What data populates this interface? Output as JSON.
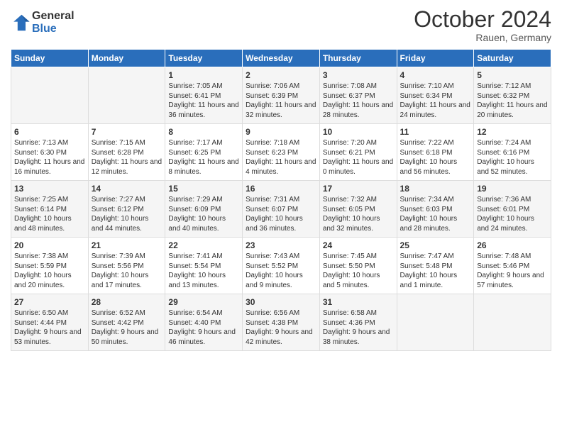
{
  "header": {
    "logo_general": "General",
    "logo_blue": "Blue",
    "month_title": "October 2024",
    "location": "Rauen, Germany"
  },
  "weekdays": [
    "Sunday",
    "Monday",
    "Tuesday",
    "Wednesday",
    "Thursday",
    "Friday",
    "Saturday"
  ],
  "weeks": [
    [
      {
        "day": "",
        "detail": ""
      },
      {
        "day": "",
        "detail": ""
      },
      {
        "day": "1",
        "detail": "Sunrise: 7:05 AM\nSunset: 6:41 PM\nDaylight: 11 hours and 36 minutes."
      },
      {
        "day": "2",
        "detail": "Sunrise: 7:06 AM\nSunset: 6:39 PM\nDaylight: 11 hours and 32 minutes."
      },
      {
        "day": "3",
        "detail": "Sunrise: 7:08 AM\nSunset: 6:37 PM\nDaylight: 11 hours and 28 minutes."
      },
      {
        "day": "4",
        "detail": "Sunrise: 7:10 AM\nSunset: 6:34 PM\nDaylight: 11 hours and 24 minutes."
      },
      {
        "day": "5",
        "detail": "Sunrise: 7:12 AM\nSunset: 6:32 PM\nDaylight: 11 hours and 20 minutes."
      }
    ],
    [
      {
        "day": "6",
        "detail": "Sunrise: 7:13 AM\nSunset: 6:30 PM\nDaylight: 11 hours and 16 minutes."
      },
      {
        "day": "7",
        "detail": "Sunrise: 7:15 AM\nSunset: 6:28 PM\nDaylight: 11 hours and 12 minutes."
      },
      {
        "day": "8",
        "detail": "Sunrise: 7:17 AM\nSunset: 6:25 PM\nDaylight: 11 hours and 8 minutes."
      },
      {
        "day": "9",
        "detail": "Sunrise: 7:18 AM\nSunset: 6:23 PM\nDaylight: 11 hours and 4 minutes."
      },
      {
        "day": "10",
        "detail": "Sunrise: 7:20 AM\nSunset: 6:21 PM\nDaylight: 11 hours and 0 minutes."
      },
      {
        "day": "11",
        "detail": "Sunrise: 7:22 AM\nSunset: 6:18 PM\nDaylight: 10 hours and 56 minutes."
      },
      {
        "day": "12",
        "detail": "Sunrise: 7:24 AM\nSunset: 6:16 PM\nDaylight: 10 hours and 52 minutes."
      }
    ],
    [
      {
        "day": "13",
        "detail": "Sunrise: 7:25 AM\nSunset: 6:14 PM\nDaylight: 10 hours and 48 minutes."
      },
      {
        "day": "14",
        "detail": "Sunrise: 7:27 AM\nSunset: 6:12 PM\nDaylight: 10 hours and 44 minutes."
      },
      {
        "day": "15",
        "detail": "Sunrise: 7:29 AM\nSunset: 6:09 PM\nDaylight: 10 hours and 40 minutes."
      },
      {
        "day": "16",
        "detail": "Sunrise: 7:31 AM\nSunset: 6:07 PM\nDaylight: 10 hours and 36 minutes."
      },
      {
        "day": "17",
        "detail": "Sunrise: 7:32 AM\nSunset: 6:05 PM\nDaylight: 10 hours and 32 minutes."
      },
      {
        "day": "18",
        "detail": "Sunrise: 7:34 AM\nSunset: 6:03 PM\nDaylight: 10 hours and 28 minutes."
      },
      {
        "day": "19",
        "detail": "Sunrise: 7:36 AM\nSunset: 6:01 PM\nDaylight: 10 hours and 24 minutes."
      }
    ],
    [
      {
        "day": "20",
        "detail": "Sunrise: 7:38 AM\nSunset: 5:59 PM\nDaylight: 10 hours and 20 minutes."
      },
      {
        "day": "21",
        "detail": "Sunrise: 7:39 AM\nSunset: 5:56 PM\nDaylight: 10 hours and 17 minutes."
      },
      {
        "day": "22",
        "detail": "Sunrise: 7:41 AM\nSunset: 5:54 PM\nDaylight: 10 hours and 13 minutes."
      },
      {
        "day": "23",
        "detail": "Sunrise: 7:43 AM\nSunset: 5:52 PM\nDaylight: 10 hours and 9 minutes."
      },
      {
        "day": "24",
        "detail": "Sunrise: 7:45 AM\nSunset: 5:50 PM\nDaylight: 10 hours and 5 minutes."
      },
      {
        "day": "25",
        "detail": "Sunrise: 7:47 AM\nSunset: 5:48 PM\nDaylight: 10 hours and 1 minute."
      },
      {
        "day": "26",
        "detail": "Sunrise: 7:48 AM\nSunset: 5:46 PM\nDaylight: 9 hours and 57 minutes."
      }
    ],
    [
      {
        "day": "27",
        "detail": "Sunrise: 6:50 AM\nSunset: 4:44 PM\nDaylight: 9 hours and 53 minutes."
      },
      {
        "day": "28",
        "detail": "Sunrise: 6:52 AM\nSunset: 4:42 PM\nDaylight: 9 hours and 50 minutes."
      },
      {
        "day": "29",
        "detail": "Sunrise: 6:54 AM\nSunset: 4:40 PM\nDaylight: 9 hours and 46 minutes."
      },
      {
        "day": "30",
        "detail": "Sunrise: 6:56 AM\nSunset: 4:38 PM\nDaylight: 9 hours and 42 minutes."
      },
      {
        "day": "31",
        "detail": "Sunrise: 6:58 AM\nSunset: 4:36 PM\nDaylight: 9 hours and 38 minutes."
      },
      {
        "day": "",
        "detail": ""
      },
      {
        "day": "",
        "detail": ""
      }
    ]
  ]
}
